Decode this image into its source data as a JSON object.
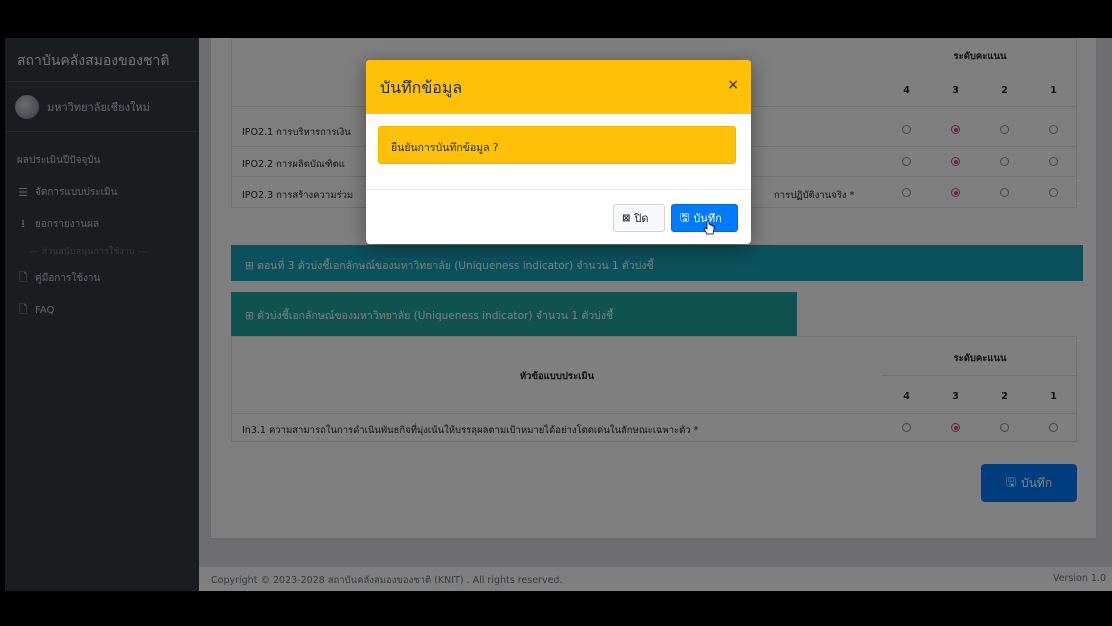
{
  "sidebar": {
    "brand": "สถาบันคลังสมองของชาติ",
    "user": "มหาวิทยาลัยเชียงใหม่",
    "items": [
      {
        "label": "ผลประเมินปีปัจจุบัน",
        "icon": ""
      },
      {
        "label": "จัดการแบบประเมิน",
        "icon": "list-check-icon"
      },
      {
        "label": "ยอกรายงานผล",
        "icon": "download-icon"
      }
    ],
    "header": "--- ส่วนสนับสนุนการใช้งาน ---",
    "support": [
      {
        "label": "คู่มือการใช้งาน",
        "icon": "file-icon"
      },
      {
        "label": "FAQ",
        "icon": "file-icon"
      }
    ]
  },
  "table1": {
    "score_header": "ระดับคะแนน",
    "levels": [
      "4",
      "3",
      "2",
      "1"
    ],
    "rows": [
      {
        "text": "IPO2.1 การบริหารการเงิน",
        "selected": "3"
      },
      {
        "text": "IPO2.2 การผลิตบัณฑิตแ",
        "selected": "3"
      },
      {
        "text": "IPO2.3 การสร้างความร่วม",
        "suffix": "การปฏิบัติงานจริง *",
        "selected": "3"
      }
    ]
  },
  "section3_banner": "ตอนที่ 3 ตัวบ่งชี้เอกลักษณ์ของมหาวิทยาลัย (Uniqueness indicator) จำนวน 1 ตัวบ่งชี้",
  "indicator_banner": "ตัวบ่งชี้เอกลักษณ์ของมหาวิทยาลัย (Uniqueness indicator) จำนวน 1 ตัวบ่งชี้",
  "table2": {
    "topic_header": "หัวข้อแบบประเมิน",
    "score_header": "ระดับคะแนน",
    "levels": [
      "4",
      "3",
      "2",
      "1"
    ],
    "rows": [
      {
        "text": "In3.1 ความสามารถในการดำเนินพันธกิจที่มุ่งเน้นให้บรรลุผลตามเป้าหมายได้อย่างโดดเด่นในลักษณะเฉพาะตัว *",
        "selected": "3"
      }
    ]
  },
  "save_button": "บันทึก",
  "footer": {
    "copyright": "Copyright © 2023-2028 สถาบันคลังสมองของชาติ (KNIT) . All rights reserved.",
    "version": "Version 1.0"
  },
  "modal": {
    "title": "บันทึกข้อมูล",
    "close_symbol": "×",
    "message": "ยืนยันการบันทึกข้อมูล ?",
    "close_label": "ปิด",
    "save_label": "บันทึก"
  },
  "colors": {
    "sidebar": "#343a40",
    "modal_header": "#ffc107",
    "primary": "#007bff",
    "banner_teal": "#17a2b8",
    "radio_selected": "#e83e8c"
  }
}
